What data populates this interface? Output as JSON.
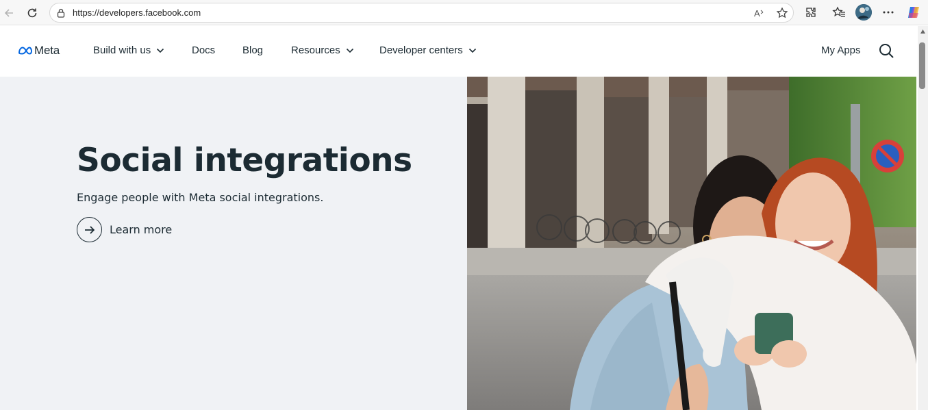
{
  "browser": {
    "url": "https://developers.facebook.com"
  },
  "header": {
    "logo_text": "Meta",
    "nav": [
      {
        "label": "Build with us"
      },
      {
        "label": "Docs"
      },
      {
        "label": "Blog"
      },
      {
        "label": "Resources"
      },
      {
        "label": "Developer centers"
      }
    ],
    "my_apps": "My Apps"
  },
  "hero": {
    "title": "Social integrations",
    "subtitle": "Engage people with Meta social integrations.",
    "cta": "Learn more"
  },
  "icons": [
    "back-icon",
    "reload-icon",
    "lock-icon",
    "read-aloud-icon",
    "favorite-star-icon",
    "extensions-icon",
    "favorites-icon",
    "profile-avatar",
    "more-icon",
    "copilot-icon",
    "meta-logo-icon",
    "chevron-down-icon",
    "search-icon",
    "arrow-right-icon"
  ],
  "colors": {
    "text": "#1c2b33",
    "hero_bg": "#f0f2f5",
    "meta_blue": "#0668e1"
  }
}
